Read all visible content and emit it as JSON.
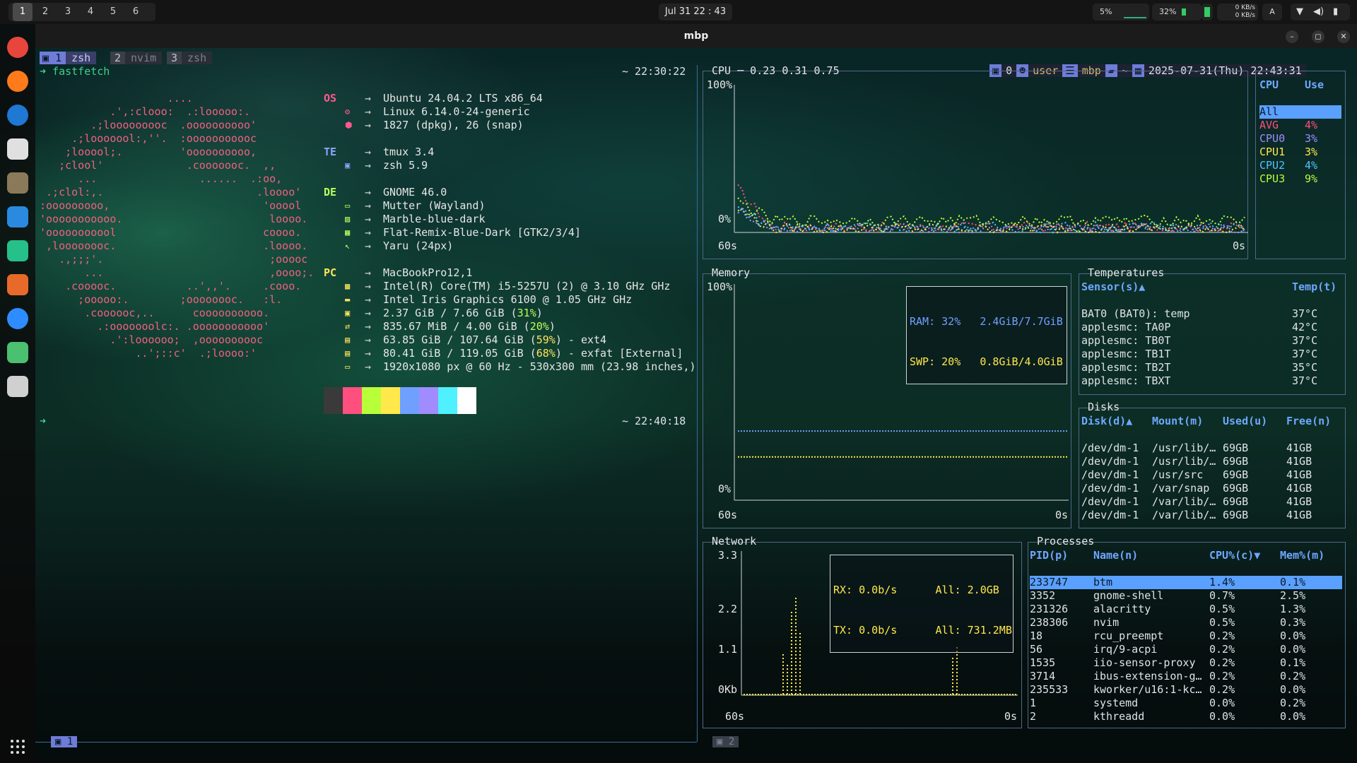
{
  "topbar": {
    "workspaces": [
      "1",
      "2",
      "3",
      "4",
      "5",
      "6"
    ],
    "active_workspace": "1",
    "clock": "Jul 31  22 : 43",
    "cpu_indicator": "5%",
    "mem_indicator": "32%",
    "net_down": "0 KB/s",
    "net_up": "0 KB/s",
    "keyboard": "A"
  },
  "window": {
    "title": "mbp",
    "minimize": "–",
    "maximize": "◻",
    "close": "✕"
  },
  "tmux": {
    "tabs": [
      {
        "index": "1",
        "name": "zsh",
        "active": true
      },
      {
        "index": "2",
        "name": "nvim",
        "active": false
      },
      {
        "index": "3",
        "name": "zsh",
        "active": false
      }
    ],
    "status_right": {
      "sessions": "0",
      "user": "user",
      "host": "mbp",
      "path": "~",
      "datetime": "2025-07-31(Thu) 22:43:31"
    },
    "bottom_left": "1",
    "bottom_right": "2"
  },
  "shell": {
    "prompt_arrow": "➜",
    "command": "fastfetch",
    "time1": "~ 22:30:22",
    "time2": "~ 22:40:18"
  },
  "fastfetch": {
    "logo": [
      "                    ....",
      "           .',:clooo:  .:looooo:.",
      "        .;looooooooc  .oooooooooo'",
      "     .;looooool:,''.  :ooooooooooc",
      "    ;looool;.         'oooooooooo,",
      "   ;clool'             .cooooooc.  ,,",
      "      ...                ......  .:oo,",
      " .;clol:,.                        .loooo'",
      ":ooooooooo,                        'ooool",
      "'ooooooooooo.                       loooo.",
      "'ooooooooool                       coooo.",
      " ,loooooooc.                       .loooo.",
      "   .,;;;'.                          ;ooooc",
      "       ...                          ,oooo;.",
      "    .cooooc.           ..',,'.     .cooo.",
      "      ;ooooo:.        ;oooooooc.   :l.",
      "       .coooooc,..      coooooooooo.",
      "         .:ooooooolc:. .ooooooooooo'",
      "           .':loooooo;  ,oooooooooc",
      "               ..';::c'  .;loooo:'"
    ],
    "groups": [
      {
        "label": "OS",
        "rows": [
          {
            "icon": "",
            "text": "Ubuntu 24.04.2 LTS x86_64"
          },
          {
            "icon": "gear",
            "text": "Linux 6.14.0-24-generic"
          },
          {
            "icon": "package",
            "text": "1827 (dpkg), 26 (snap)"
          }
        ]
      },
      {
        "label": "TE",
        "rows": [
          {
            "icon": "",
            "text": "tmux 3.4"
          },
          {
            "icon": "terminal",
            "text": "zsh 5.9"
          }
        ]
      },
      {
        "label": "DE",
        "rows": [
          {
            "icon": "",
            "text": "GNOME 46.0"
          },
          {
            "icon": "window",
            "text": "Mutter (Wayland)"
          },
          {
            "icon": "theme",
            "text": "Marble-blue-dark"
          },
          {
            "icon": "grid",
            "text": "Flat-Remix-Blue-Dark [GTK2/3/4]"
          },
          {
            "icon": "cursor",
            "text": "Yaru (24px)"
          }
        ]
      },
      {
        "label": "PC",
        "rows": [
          {
            "icon": "",
            "text": "MacBookPro12,1"
          },
          {
            "icon": "cpu",
            "text": "Intel(R) Core(TM) i5-5257U (2) @ 3.10 GHz GHz"
          },
          {
            "icon": "gpu",
            "text": "Intel Iris Graphics 6100 @ 1.05 GHz GHz"
          },
          {
            "icon": "memory",
            "text": "2.37 GiB / 7.66 GiB (",
            "pct": "31%",
            "tail": ")"
          },
          {
            "icon": "swap",
            "text": "835.67 MiB / 4.00 GiB (",
            "pct": "20%",
            "tail": ")"
          },
          {
            "icon": "disk",
            "text": "63.85 GiB / 107.64 GiB (",
            "pct": "59%",
            "tail": ") - ext4",
            "warn": true
          },
          {
            "icon": "disk",
            "text": "80.41 GiB / 119.05 GiB (",
            "pct": "68%",
            "tail": ") - exfat [External]",
            "warn": true
          },
          {
            "icon": "display",
            "text": "1920x1080 px @ 60 Hz - 530x300 mm (23.98 inches,)"
          }
        ]
      }
    ],
    "palette": [
      "#3a3a3a",
      "#ff4f7f",
      "#b8ff3a",
      "#ffe84a",
      "#6fa0ff",
      "#a08cff",
      "#4ff0ff",
      "#ffffff"
    ]
  },
  "btm": {
    "cpu": {
      "title": "CPU ─ 0.23 0.31 0.75",
      "y_top": "100%",
      "y_bottom": "0%",
      "x_left": "60s",
      "x_right": "0s",
      "legend_header": [
        "CPU",
        "Use"
      ],
      "legend": [
        {
          "name": "All",
          "use": "",
          "color": "#5aa0ff",
          "selected": true
        },
        {
          "name": "AVG",
          "use": "4%",
          "color": "#ff4f7f"
        },
        {
          "name": "CPU0",
          "use": "3%",
          "color": "#a08cff"
        },
        {
          "name": "CPU1",
          "use": "3%",
          "color": "#ffe84a"
        },
        {
          "name": "CPU2",
          "use": "4%",
          "color": "#4fc3ff"
        },
        {
          "name": "CPU3",
          "use": "9%",
          "color": "#b8ff3a"
        }
      ]
    },
    "memory": {
      "title": "Memory",
      "y_top": "100%",
      "y_bottom": "0%",
      "x_left": "60s",
      "x_right": "0s",
      "ram_label": "RAM: 32%",
      "ram_val": "2.4GiB/7.7GiB",
      "swp_label": "SWP: 20%",
      "swp_val": "0.8GiB/4.0GiB",
      "ram_pct": 32,
      "swp_pct": 20
    },
    "temps": {
      "title": "Temperatures",
      "headers": [
        "Sensor(s)▲",
        "Temp(t)"
      ],
      "rows": [
        [
          "BAT0 (BAT0): temp",
          "37°C"
        ],
        [
          "applesmc: TA0P",
          "42°C"
        ],
        [
          "applesmc: TB0T",
          "37°C"
        ],
        [
          "applesmc: TB1T",
          "37°C"
        ],
        [
          "applesmc: TB2T",
          "35°C"
        ],
        [
          "applesmc: TBXT",
          "37°C"
        ]
      ]
    },
    "disks": {
      "title": "Disks",
      "headers": [
        "Disk(d)▲",
        "Mount(m)",
        "Used(u)",
        "Free(n)"
      ],
      "rows": [
        [
          "/dev/dm-1",
          "/usr/lib/…",
          "69GB",
          "41GB"
        ],
        [
          "/dev/dm-1",
          "/usr/lib/…",
          "69GB",
          "41GB"
        ],
        [
          "/dev/dm-1",
          "/usr/src",
          "69GB",
          "41GB"
        ],
        [
          "/dev/dm-1",
          "/var/snap",
          "69GB",
          "41GB"
        ],
        [
          "/dev/dm-1",
          "/var/lib/…",
          "69GB",
          "41GB"
        ],
        [
          "/dev/dm-1",
          "/var/lib/…",
          "69GB",
          "41GB"
        ]
      ]
    },
    "network": {
      "title": "Network",
      "y_ticks": [
        "3.3",
        "2.2",
        "1.1",
        "0Kb"
      ],
      "x_left": "60s",
      "x_right": "0s",
      "rx": "RX: 0.0b/s",
      "rx_all": "All: 2.0GB",
      "tx": "TX: 0.0b/s",
      "tx_all": "All: 731.2MB"
    },
    "processes": {
      "title": "Processes",
      "headers": [
        "PID(p)",
        "Name(n)",
        "CPU%(c)▼",
        "Mem%(m)"
      ],
      "rows": [
        [
          "233747",
          "btm",
          "1.4%",
          "0.1%"
        ],
        [
          "3352",
          "gnome-shell",
          "0.7%",
          "2.5%"
        ],
        [
          "231326",
          "alacritty",
          "0.5%",
          "1.3%"
        ],
        [
          "238306",
          "nvim",
          "0.5%",
          "0.3%"
        ],
        [
          "18",
          "rcu_preempt",
          "0.2%",
          "0.0%"
        ],
        [
          "56",
          "irq/9-acpi",
          "0.2%",
          "0.0%"
        ],
        [
          "1535",
          "iio-sensor-proxy",
          "0.2%",
          "0.1%"
        ],
        [
          "3714",
          "ibus-extension-g…",
          "0.2%",
          "0.2%"
        ],
        [
          "235533",
          "kworker/u16:1-kc…",
          "0.2%",
          "0.0%"
        ],
        [
          "1",
          "systemd",
          "0.0%",
          "0.2%"
        ],
        [
          "2",
          "kthreadd",
          "0.0%",
          "0.0%"
        ]
      ]
    }
  },
  "dock_apps": [
    "chrome-icon",
    "firefox-icon",
    "thunderbird-icon",
    "files-icon",
    "gimp-icon",
    "vscode-icon",
    "vscode-insiders-icon",
    "archi-icon",
    "zoom-icon",
    "android-studio-icon",
    "trash-icon"
  ]
}
